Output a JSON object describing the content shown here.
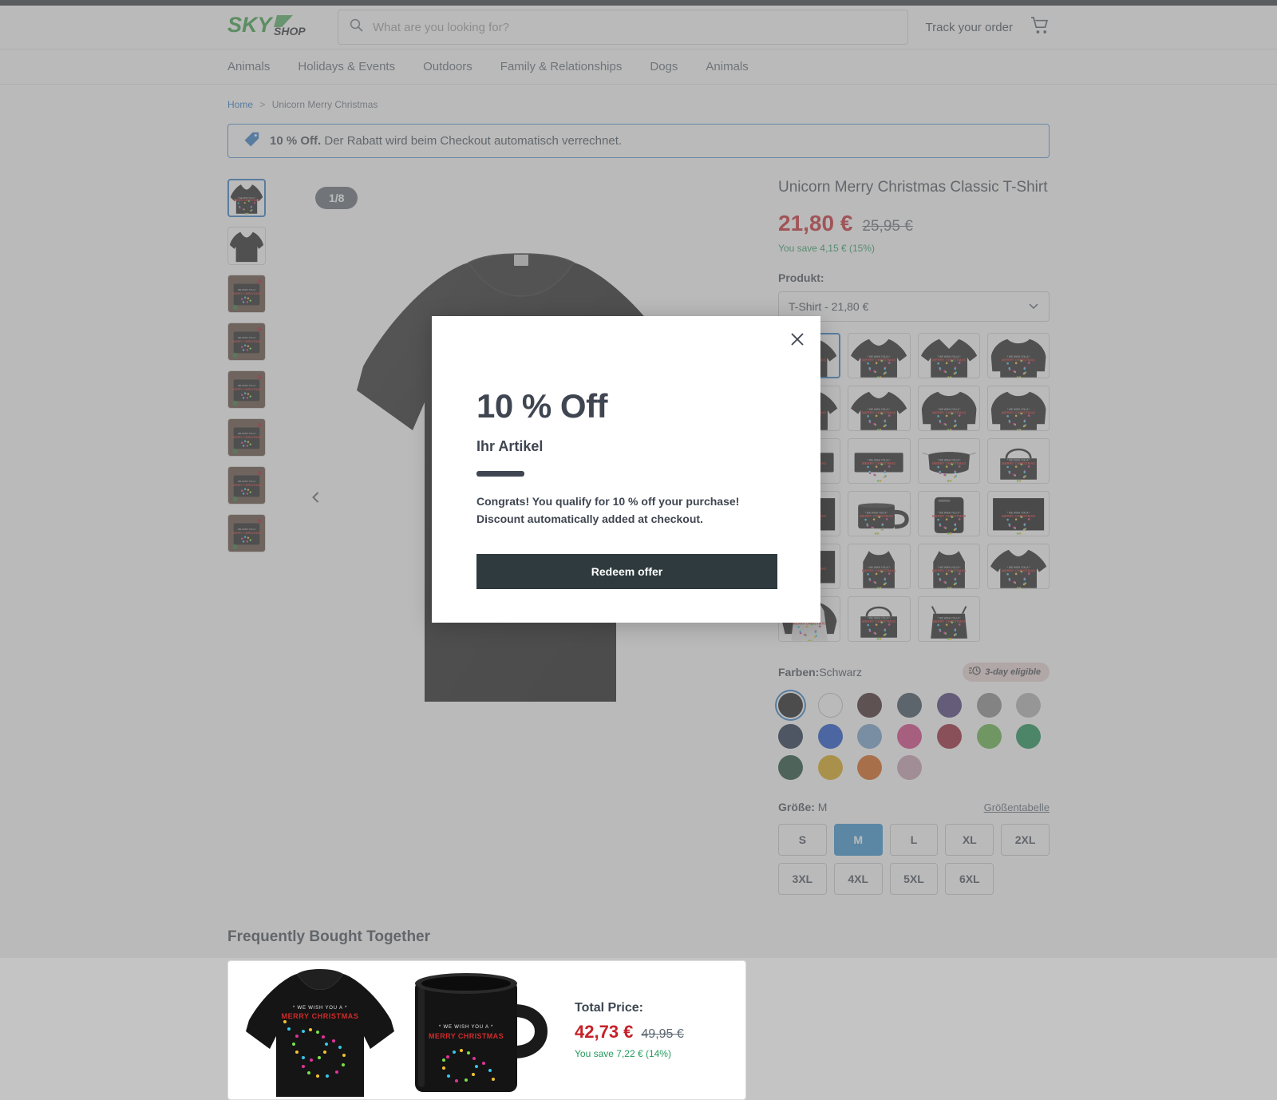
{
  "header": {
    "logo_text_primary": "SKY",
    "logo_text_secondary": "SHOP",
    "search_placeholder": "What are you looking for?",
    "search_value": "",
    "track_order_label": "Track your order",
    "cart_icon": "shopping-cart-icon",
    "search_icon": "search-icon"
  },
  "nav": {
    "items": [
      {
        "label": "Animals"
      },
      {
        "label": "Holidays & Events"
      },
      {
        "label": "Outdoors"
      },
      {
        "label": "Family & Relationships"
      },
      {
        "label": "Dogs"
      },
      {
        "label": "Animals"
      }
    ]
  },
  "breadcrumb": {
    "home": "Home",
    "separator": ">",
    "current": "Unicorn Merry Christmas"
  },
  "promo_banner": {
    "icon": "tag-icon",
    "bold_text": "10 % Off.",
    "text": "Der Rabatt wird beim Checkout automatisch verrechnet.",
    "border_color": "#4a90d9"
  },
  "gallery": {
    "counter": "1/8",
    "prev_arrow_icon": "chevron-left-icon",
    "thumbnails": [
      {
        "name": "thumb-front-print",
        "active": true
      },
      {
        "name": "thumb-back-plain",
        "active": false
      },
      {
        "name": "thumb-flatlay-flowers",
        "active": false
      },
      {
        "name": "thumb-flatlay-wood",
        "active": false
      },
      {
        "name": "thumb-flatlay-hand",
        "active": false
      },
      {
        "name": "thumb-flatlay-gift",
        "active": false
      },
      {
        "name": "thumb-flatlay-plaid",
        "active": false
      },
      {
        "name": "thumb-flatlay-holly",
        "active": false
      }
    ]
  },
  "product": {
    "title": "Unicorn Merry Christmas Classic T-Shirt",
    "price_current": "21,80 €",
    "price_original": "25,95 €",
    "savings": "You save 4,15 € (15%)",
    "product_label": "Produkt:",
    "product_selected": "T-Shirt - 21,80 €",
    "dropdown_icon": "chevron-down-icon",
    "variants": [
      {
        "name": "variant-classic-tshirt",
        "active": true
      },
      {
        "name": "variant-premium-tshirt",
        "active": false
      },
      {
        "name": "variant-vneck-tshirt",
        "active": false
      },
      {
        "name": "variant-hoodie",
        "active": false
      },
      {
        "name": "variant-ladies-tshirt",
        "active": false
      },
      {
        "name": "variant-youth-tshirt",
        "active": false
      },
      {
        "name": "variant-long-sleeve",
        "active": false
      },
      {
        "name": "variant-sweatshirt",
        "active": false
      },
      {
        "name": "variant-sticker",
        "active": false
      },
      {
        "name": "variant-pillow",
        "active": false
      },
      {
        "name": "variant-face-mask",
        "active": false
      },
      {
        "name": "variant-tote-bag",
        "active": false
      },
      {
        "name": "variant-ornament",
        "active": false
      },
      {
        "name": "variant-mug",
        "active": false
      },
      {
        "name": "variant-phone-case",
        "active": false
      },
      {
        "name": "variant-poster",
        "active": false
      },
      {
        "name": "variant-blanket",
        "active": false
      },
      {
        "name": "variant-mens-tank",
        "active": false
      },
      {
        "name": "variant-ladies-tank",
        "active": false
      },
      {
        "name": "variant-onesie",
        "active": false
      },
      {
        "name": "variant-raglan",
        "active": false
      },
      {
        "name": "variant-canvas-tote",
        "active": false
      },
      {
        "name": "variant-drawstring-bag",
        "active": false
      }
    ],
    "color_label": "Farben:",
    "color_selected": "Schwarz",
    "shipping_badge": {
      "icon": "clock-fast-icon",
      "label": "3-day eligible",
      "background": "#e8d6d2"
    },
    "colors": [
      {
        "name": "Schwarz",
        "hex": "#0d0d0d",
        "selected": true,
        "light": false
      },
      {
        "name": "Weiss",
        "hex": "#ffffff",
        "selected": false,
        "light": true
      },
      {
        "name": "Dunkelbraun",
        "hex": "#34191a",
        "selected": false,
        "light": false
      },
      {
        "name": "Dunkles Heidegrau",
        "hex": "#2f4252",
        "selected": false,
        "light": false
      },
      {
        "name": "Violett",
        "hex": "#433072",
        "selected": false,
        "light": false
      },
      {
        "name": "Grau",
        "hex": "#858585",
        "selected": false,
        "light": false
      },
      {
        "name": "Hellgrau",
        "hex": "#b0b0b0",
        "selected": false,
        "light": false
      },
      {
        "name": "Marineblau",
        "hex": "#0f233d",
        "selected": false,
        "light": false
      },
      {
        "name": "Royalblau",
        "hex": "#0d46c8",
        "selected": false,
        "light": false
      },
      {
        "name": "Hellblau",
        "hex": "#6f9dc9",
        "selected": false,
        "light": false
      },
      {
        "name": "Pink",
        "hex": "#d6357e",
        "selected": false,
        "light": false
      },
      {
        "name": "Dunkelrot",
        "hex": "#961428",
        "selected": false,
        "light": false
      },
      {
        "name": "Hellgrün",
        "hex": "#5cb13f",
        "selected": false,
        "light": false
      },
      {
        "name": "Grün",
        "hex": "#0f8a4a",
        "selected": false,
        "light": false
      },
      {
        "name": "Dunkelgrün",
        "hex": "#11402c",
        "selected": false,
        "light": false
      },
      {
        "name": "Gold",
        "hex": "#dba40a",
        "selected": false,
        "light": false
      },
      {
        "name": "Orange",
        "hex": "#d85a09",
        "selected": false,
        "light": false
      },
      {
        "name": "Altrosa",
        "hex": "#c79bb0",
        "selected": false,
        "light": false
      }
    ],
    "size_label": "Größe:",
    "size_selected": "M",
    "size_chart_link": "Größentabelle",
    "sizes": [
      {
        "label": "S",
        "selected": false
      },
      {
        "label": "M",
        "selected": true
      },
      {
        "label": "L",
        "selected": false
      },
      {
        "label": "XL",
        "selected": false
      },
      {
        "label": "2XL",
        "selected": false
      },
      {
        "label": "3XL",
        "selected": false
      },
      {
        "label": "4XL",
        "selected": false
      },
      {
        "label": "5XL",
        "selected": false
      },
      {
        "label": "6XL",
        "selected": false
      }
    ]
  },
  "frequently_bought": {
    "title": "Frequently Bought Together",
    "items": [
      {
        "name": "fbt-tshirt"
      },
      {
        "name": "fbt-mug"
      }
    ],
    "total_label": "Total Price:",
    "total_current": "42,73 €",
    "total_original": "49,95 €",
    "total_savings": "You save 7,22 € (14%)"
  },
  "modal": {
    "close_icon": "close-icon",
    "heading": "10 % Off",
    "subheading": "Ihr Artikel",
    "body": "Congrats! You qualify for 10 % off your purchase! Discount automatically added at checkout.",
    "button_label": "Redeem offer",
    "button_color": "#2e3a3d"
  }
}
